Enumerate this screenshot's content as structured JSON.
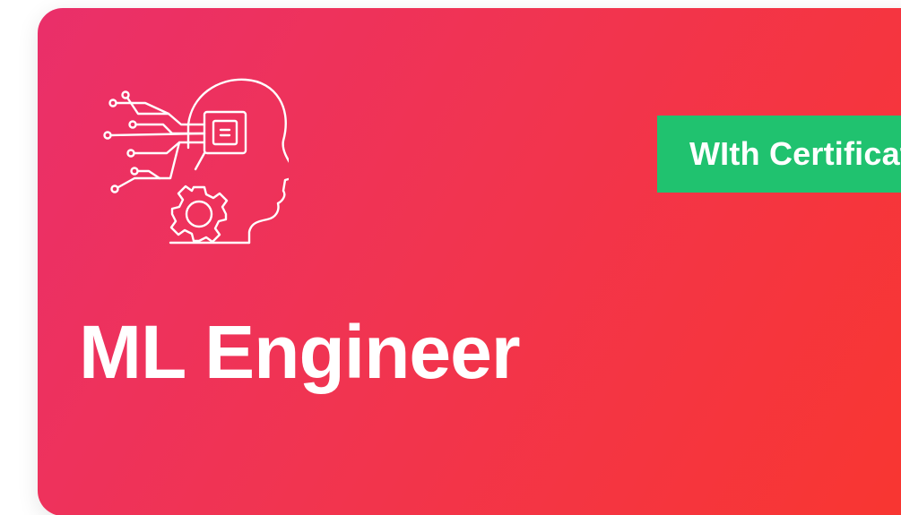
{
  "card": {
    "icon": "ai-head-circuit-gear-icon",
    "badge_label": "WIth Certificate",
    "title": "ML Engineer"
  },
  "colors": {
    "gradient_start": "#ea2f6a",
    "gradient_end": "#f9362f",
    "badge": "#20c26f",
    "text": "#ffffff"
  }
}
